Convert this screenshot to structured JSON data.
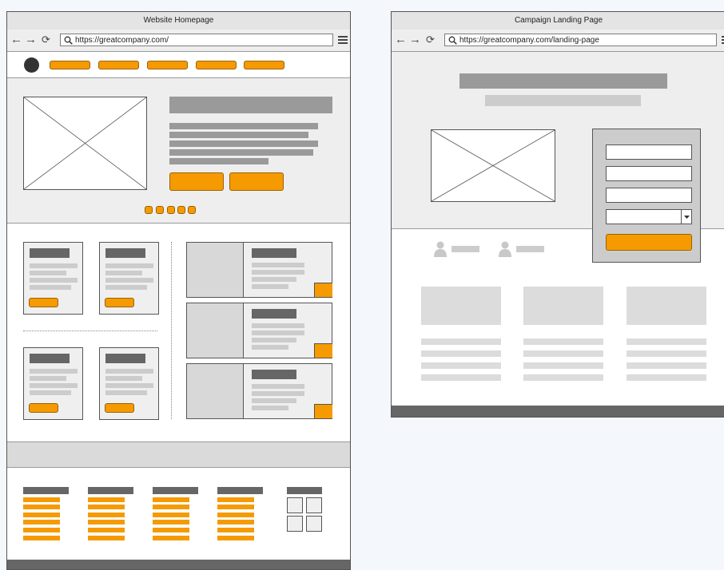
{
  "colors": {
    "accent": "#f59a00",
    "accent_border": "#9b6200",
    "page_background": "#f4f7fb"
  },
  "homepage_window": {
    "title": "Website Homepage",
    "url": "https://greatcompany.com/",
    "nav_icons": {
      "back": "back-arrow-icon",
      "forward": "forward-arrow-icon",
      "reload": "reload-icon",
      "search": "search-icon",
      "menu": "hamburger-menu-icon"
    },
    "carousel_dots": 5,
    "footer_columns": 4
  },
  "landing_window": {
    "title": "Campaign Landing Page",
    "url": "https://greatcompany.com/landing-page",
    "form": {
      "input_fields": 3,
      "has_dropdown": true
    },
    "testimonial_icons": [
      "user-icon",
      "user-icon"
    ],
    "feature_columns": 3
  }
}
